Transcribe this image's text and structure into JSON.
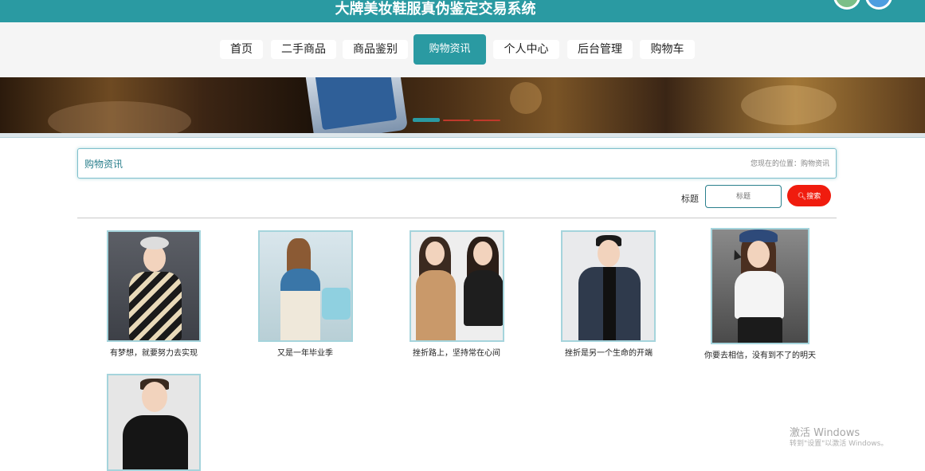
{
  "header": {
    "title": "大牌美妆鞋服真伪鉴定交易系统"
  },
  "nav": {
    "items": [
      {
        "label": "首页"
      },
      {
        "label": "二手商品"
      },
      {
        "label": "商品鉴别"
      },
      {
        "label": "购物资讯"
      },
      {
        "label": "个人中心"
      },
      {
        "label": "后台管理"
      },
      {
        "label": "购物车"
      }
    ],
    "active_index": 3
  },
  "breadcrumb": {
    "title": "购物资讯",
    "location": "您现在的位置：购物资讯"
  },
  "search": {
    "label": "标题",
    "placeholder": "标题",
    "button_label": "搜索"
  },
  "articles": [
    {
      "title": "有梦想，就要努力去实现"
    },
    {
      "title": "又是一年毕业季"
    },
    {
      "title": "挫折路上，坚持常在心间"
    },
    {
      "title": "挫折是另一个生命的开端"
    },
    {
      "title": "你要去相信，没有到不了的明天"
    },
    {
      "title": ""
    }
  ],
  "watermark": {
    "line1": "激活 Windows",
    "line2": "转到\"设置\"以激活 Windows。"
  },
  "colors": {
    "accent": "#2a9aa2",
    "search_button": "#f01c0e"
  }
}
